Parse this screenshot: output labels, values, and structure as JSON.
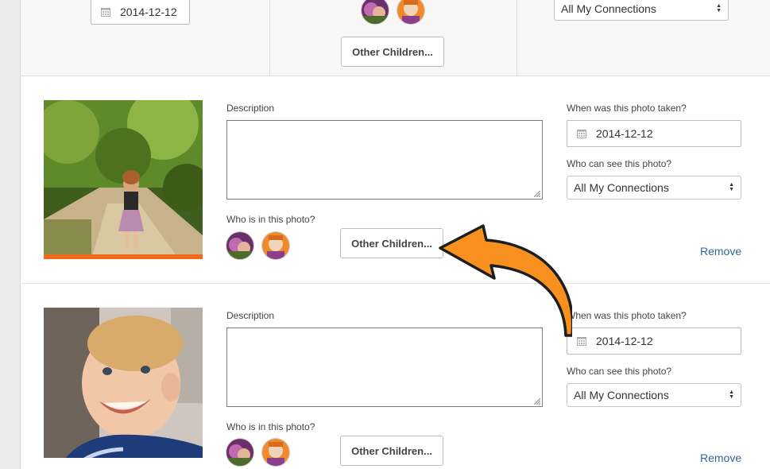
{
  "top_row": {
    "date_value": "2014-12-12",
    "visibility_value": "All My Connections",
    "other_children_label": "Other Children..."
  },
  "entries": [
    {
      "description_label": "Description",
      "description_value": "",
      "who_label": "Who is in this photo?",
      "other_children_label": "Other Children...",
      "date_label": "When was this photo taken?",
      "date_value": "2014-12-12",
      "visibility_label": "Who can see this photo?",
      "visibility_value": "All My Connections",
      "remove_label": "Remove",
      "photo_icon": "girl-on-forest-path-photo"
    },
    {
      "description_label": "Description",
      "description_value": "",
      "who_label": "Who is in this photo?",
      "other_children_label": "Other Children...",
      "date_label": "When was this photo taken?",
      "date_value": "2014-12-12",
      "visibility_label": "Who can see this photo?",
      "visibility_value": "All My Connections",
      "remove_label": "Remove",
      "photo_icon": "smiling-baby-photo"
    }
  ],
  "colors": {
    "accent_orange": "#f26b1d",
    "arrow_orange": "#f7901e",
    "link_blue": "#336699",
    "border": "#bdbdbd"
  }
}
